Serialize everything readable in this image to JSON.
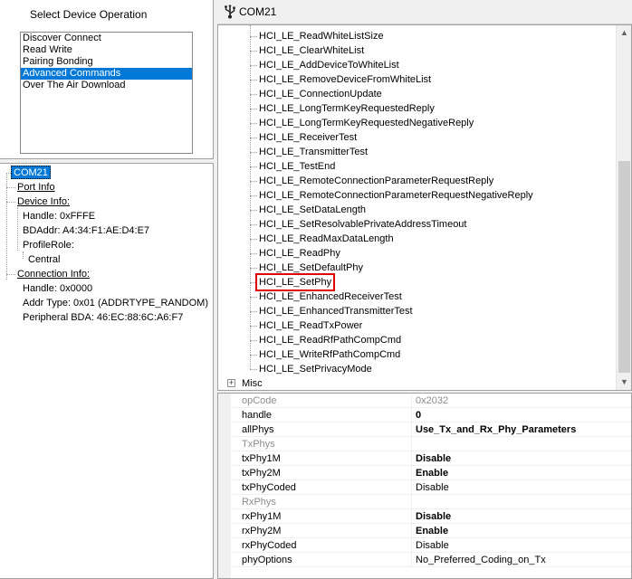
{
  "operations": {
    "title": "Select Device Operation",
    "items": [
      "Discover Connect",
      "Read Write",
      "Pairing Bonding",
      "Advanced Commands",
      "Over The Air Download"
    ],
    "selected_index": 3
  },
  "device": {
    "root": "COM21",
    "port_info": "Port Info",
    "device_info": "Device Info:",
    "handle": "Handle: 0xFFFE",
    "bdaddr": "BDAddr: A4:34:F1:AE:D4:E7",
    "profile_role": "ProfileRole:",
    "role": "Central",
    "connection_info": "Connection Info:",
    "conn_handle": "Handle: 0x0000",
    "addr_type": "Addr Type: 0x01 (ADDRTYPE_RANDOM)",
    "peer_bda": "Peripheral BDA: 46:EC:88:6C:A6:F7"
  },
  "header": {
    "title": "COM21",
    "icon": "usb-port-icon"
  },
  "commands": {
    "items": [
      "HCI_LE_ReadWhiteListSize",
      "HCI_LE_ClearWhiteList",
      "HCI_LE_AddDeviceToWhiteList",
      "HCI_LE_RemoveDeviceFromWhiteList",
      "HCI_LE_ConnectionUpdate",
      "HCI_LE_LongTermKeyRequestedReply",
      "HCI_LE_LongTermKeyRequestedNegativeReply",
      "HCI_LE_ReceiverTest",
      "HCI_LE_TransmitterTest",
      "HCI_LE_TestEnd",
      "HCI_LE_RemoteConnectionParameterRequestReply",
      "HCI_LE_RemoteConnectionParameterRequestNegativeReply",
      "HCI_LE_SetDataLength",
      "HCI_LE_SetResolvablePrivateAddressTimeout",
      "HCI_LE_ReadMaxDataLength",
      "HCI_LE_ReadPhy",
      "HCI_LE_SetDefaultPhy",
      "HCI_LE_SetPhy",
      "HCI_LE_EnhancedReceiverTest",
      "HCI_LE_EnhancedTransmitterTest",
      "HCI_LE_ReadTxPower",
      "HCI_LE_ReadRfPathCompCmd",
      "HCI_LE_WriteRfPathCompCmd",
      "HCI_LE_SetPrivacyMode"
    ],
    "selected": "HCI_LE_SetPhy",
    "misc": "Misc",
    "misc_expander": "+"
  },
  "properties": {
    "rows": [
      {
        "name": "opCode",
        "value": "0x2032",
        "style": "grey"
      },
      {
        "name": "handle",
        "value": "0",
        "style": "bold"
      },
      {
        "name": "allPhys",
        "value": "Use_Tx_and_Rx_Phy_Parameters",
        "style": "bold"
      },
      {
        "name": "TxPhys",
        "value": "",
        "style": "grey"
      },
      {
        "name": "txPhy1M",
        "value": "Disable",
        "style": "bold"
      },
      {
        "name": "txPhy2M",
        "value": "Enable",
        "style": "bold"
      },
      {
        "name": "txPhyCoded",
        "value": "Disable",
        "style": "normal"
      },
      {
        "name": "RxPhys",
        "value": "",
        "style": "grey"
      },
      {
        "name": "rxPhy1M",
        "value": "Disable",
        "style": "bold"
      },
      {
        "name": "rxPhy2M",
        "value": "Enable",
        "style": "bold"
      },
      {
        "name": "rxPhyCoded",
        "value": "Disable",
        "style": "normal"
      },
      {
        "name": "phyOptions",
        "value": "No_Preferred_Coding_on_Tx",
        "style": "normal"
      }
    ]
  },
  "colors": {
    "selection": "#0078d7",
    "highlight_border": "#e00000"
  }
}
